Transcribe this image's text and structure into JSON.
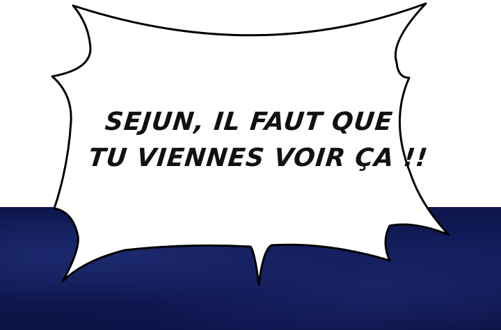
{
  "speech_bubble": {
    "lines": [
      "SEJUN, IL FAUT QUE",
      "TU VIENNES VOIR ÇA !!"
    ]
  },
  "colors": {
    "background_top": "#ffffff",
    "background_bottom": "#0d164c",
    "bubble_fill": "#ffffff",
    "bubble_outline": "#000000",
    "text": "#111111"
  }
}
